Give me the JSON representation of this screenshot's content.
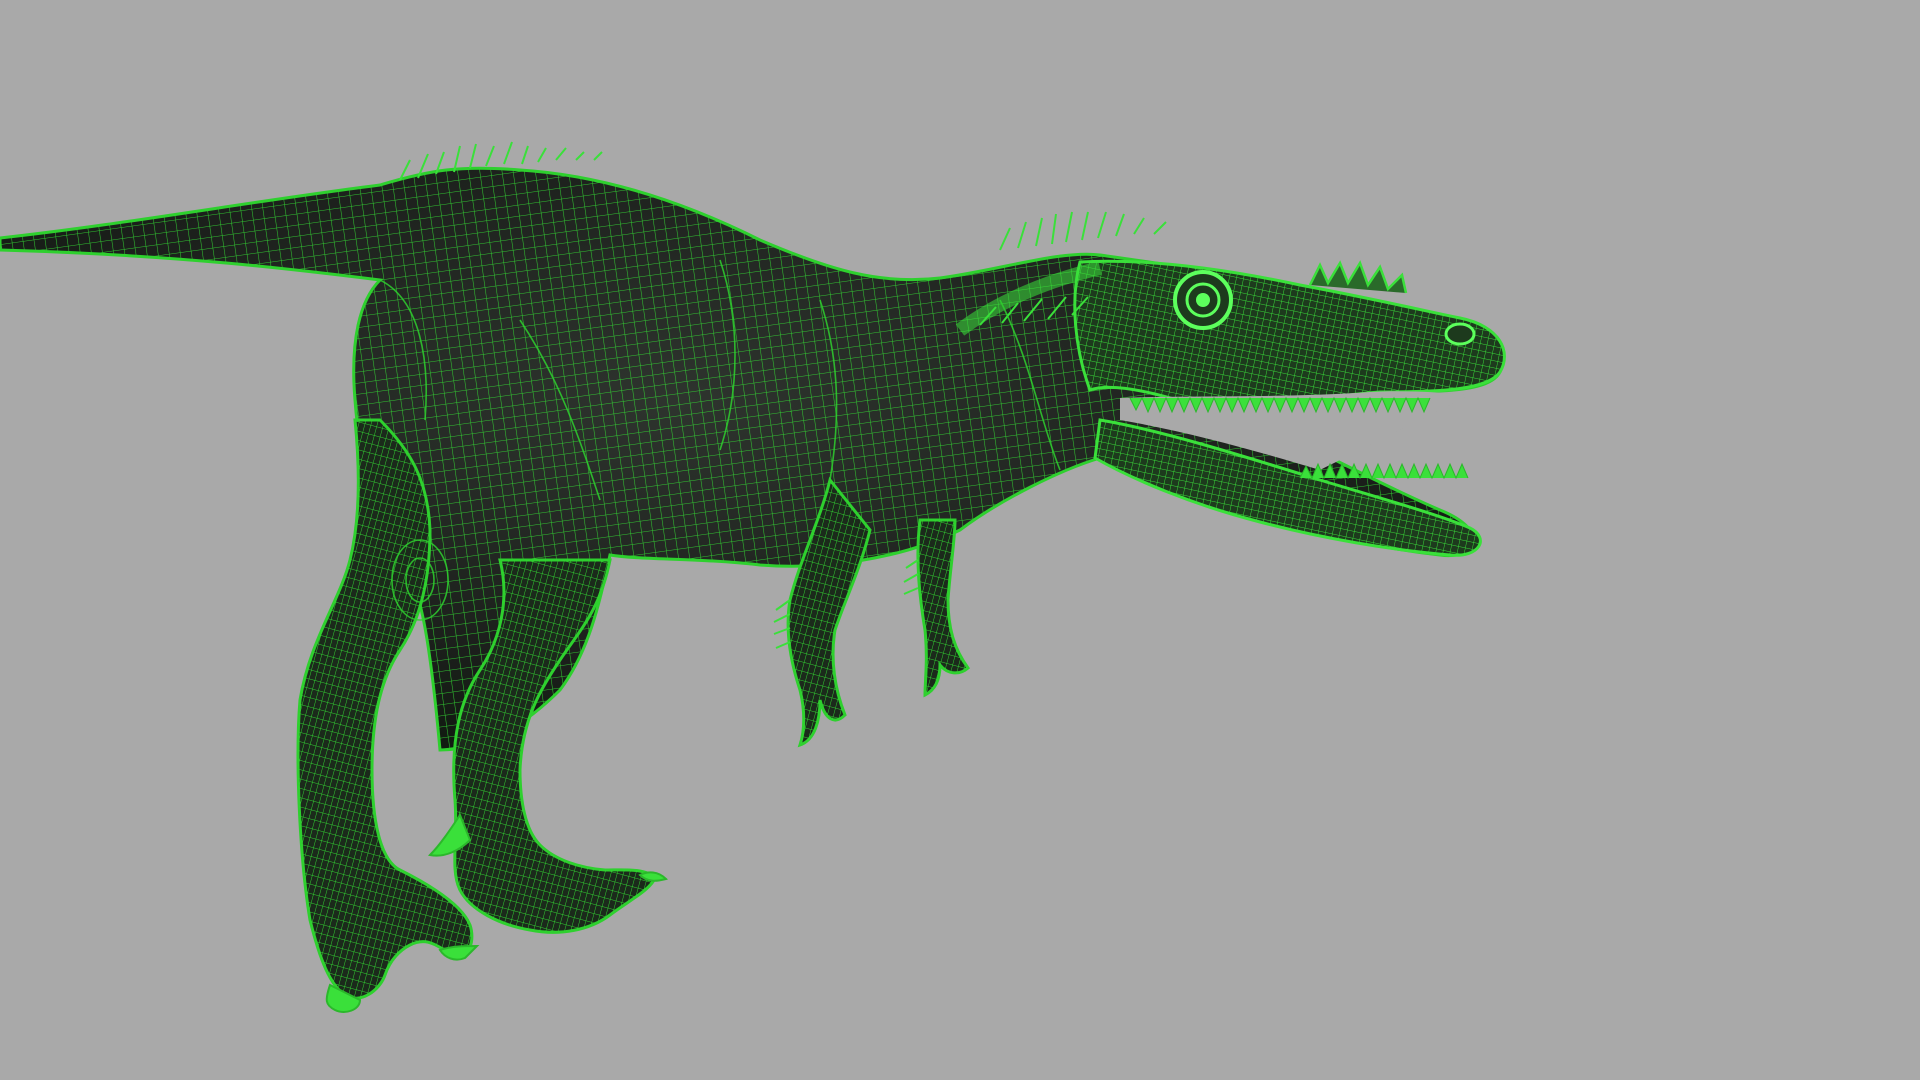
{
  "scene": {
    "background_color": "#a9a9a9",
    "subject": "dinosaur-wireframe-mesh",
    "display_mode": "wireframe-on-shaded",
    "mesh_fill_color": "#1c2a1c",
    "wire_color": "#33d633",
    "wire_highlight_color": "#5cff5c"
  }
}
